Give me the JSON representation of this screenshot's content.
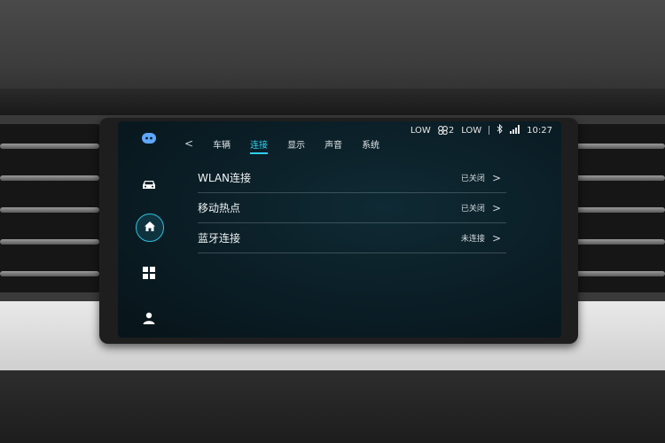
{
  "status": {
    "left_fan": "LOW",
    "fan_icon": "fan-icon",
    "fan_level": "2",
    "right_fan": "LOW",
    "bluetooth_icon": "bluetooth-icon",
    "signal_icon": "signal-icon",
    "time": "10:27"
  },
  "sidebar": {
    "items": [
      {
        "icon": "voice-assistant-icon"
      },
      {
        "icon": "car-icon"
      },
      {
        "icon": "home-icon",
        "active": true
      },
      {
        "icon": "apps-grid-icon"
      },
      {
        "icon": "user-icon"
      }
    ]
  },
  "tabs": {
    "back": "<",
    "items": [
      "车辆",
      "连接",
      "显示",
      "声音",
      "系统"
    ],
    "active": "连接"
  },
  "settings": [
    {
      "label": "WLAN连接",
      "value": "已关闭"
    },
    {
      "label": "移动热点",
      "value": "已关闭"
    },
    {
      "label": "蓝牙连接",
      "value": "未连接"
    }
  ],
  "colors": {
    "accent": "#2fd0ef",
    "screen_bg": "#0a1c24"
  }
}
